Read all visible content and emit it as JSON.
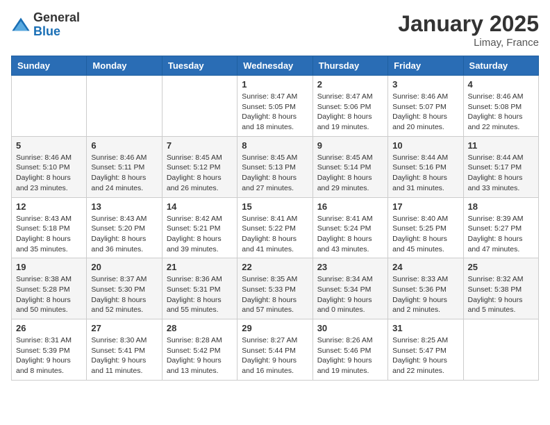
{
  "logo": {
    "general": "General",
    "blue": "Blue"
  },
  "title": "January 2025",
  "location": "Limay, France",
  "days_header": [
    "Sunday",
    "Monday",
    "Tuesday",
    "Wednesday",
    "Thursday",
    "Friday",
    "Saturday"
  ],
  "weeks": [
    [
      {
        "day": "",
        "info": ""
      },
      {
        "day": "",
        "info": ""
      },
      {
        "day": "",
        "info": ""
      },
      {
        "day": "1",
        "info": "Sunrise: 8:47 AM\nSunset: 5:05 PM\nDaylight: 8 hours and 18 minutes."
      },
      {
        "day": "2",
        "info": "Sunrise: 8:47 AM\nSunset: 5:06 PM\nDaylight: 8 hours and 19 minutes."
      },
      {
        "day": "3",
        "info": "Sunrise: 8:46 AM\nSunset: 5:07 PM\nDaylight: 8 hours and 20 minutes."
      },
      {
        "day": "4",
        "info": "Sunrise: 8:46 AM\nSunset: 5:08 PM\nDaylight: 8 hours and 22 minutes."
      }
    ],
    [
      {
        "day": "5",
        "info": "Sunrise: 8:46 AM\nSunset: 5:10 PM\nDaylight: 8 hours and 23 minutes."
      },
      {
        "day": "6",
        "info": "Sunrise: 8:46 AM\nSunset: 5:11 PM\nDaylight: 8 hours and 24 minutes."
      },
      {
        "day": "7",
        "info": "Sunrise: 8:45 AM\nSunset: 5:12 PM\nDaylight: 8 hours and 26 minutes."
      },
      {
        "day": "8",
        "info": "Sunrise: 8:45 AM\nSunset: 5:13 PM\nDaylight: 8 hours and 27 minutes."
      },
      {
        "day": "9",
        "info": "Sunrise: 8:45 AM\nSunset: 5:14 PM\nDaylight: 8 hours and 29 minutes."
      },
      {
        "day": "10",
        "info": "Sunrise: 8:44 AM\nSunset: 5:16 PM\nDaylight: 8 hours and 31 minutes."
      },
      {
        "day": "11",
        "info": "Sunrise: 8:44 AM\nSunset: 5:17 PM\nDaylight: 8 hours and 33 minutes."
      }
    ],
    [
      {
        "day": "12",
        "info": "Sunrise: 8:43 AM\nSunset: 5:18 PM\nDaylight: 8 hours and 35 minutes."
      },
      {
        "day": "13",
        "info": "Sunrise: 8:43 AM\nSunset: 5:20 PM\nDaylight: 8 hours and 36 minutes."
      },
      {
        "day": "14",
        "info": "Sunrise: 8:42 AM\nSunset: 5:21 PM\nDaylight: 8 hours and 39 minutes."
      },
      {
        "day": "15",
        "info": "Sunrise: 8:41 AM\nSunset: 5:22 PM\nDaylight: 8 hours and 41 minutes."
      },
      {
        "day": "16",
        "info": "Sunrise: 8:41 AM\nSunset: 5:24 PM\nDaylight: 8 hours and 43 minutes."
      },
      {
        "day": "17",
        "info": "Sunrise: 8:40 AM\nSunset: 5:25 PM\nDaylight: 8 hours and 45 minutes."
      },
      {
        "day": "18",
        "info": "Sunrise: 8:39 AM\nSunset: 5:27 PM\nDaylight: 8 hours and 47 minutes."
      }
    ],
    [
      {
        "day": "19",
        "info": "Sunrise: 8:38 AM\nSunset: 5:28 PM\nDaylight: 8 hours and 50 minutes."
      },
      {
        "day": "20",
        "info": "Sunrise: 8:37 AM\nSunset: 5:30 PM\nDaylight: 8 hours and 52 minutes."
      },
      {
        "day": "21",
        "info": "Sunrise: 8:36 AM\nSunset: 5:31 PM\nDaylight: 8 hours and 55 minutes."
      },
      {
        "day": "22",
        "info": "Sunrise: 8:35 AM\nSunset: 5:33 PM\nDaylight: 8 hours and 57 minutes."
      },
      {
        "day": "23",
        "info": "Sunrise: 8:34 AM\nSunset: 5:34 PM\nDaylight: 9 hours and 0 minutes."
      },
      {
        "day": "24",
        "info": "Sunrise: 8:33 AM\nSunset: 5:36 PM\nDaylight: 9 hours and 2 minutes."
      },
      {
        "day": "25",
        "info": "Sunrise: 8:32 AM\nSunset: 5:38 PM\nDaylight: 9 hours and 5 minutes."
      }
    ],
    [
      {
        "day": "26",
        "info": "Sunrise: 8:31 AM\nSunset: 5:39 PM\nDaylight: 9 hours and 8 minutes."
      },
      {
        "day": "27",
        "info": "Sunrise: 8:30 AM\nSunset: 5:41 PM\nDaylight: 9 hours and 11 minutes."
      },
      {
        "day": "28",
        "info": "Sunrise: 8:28 AM\nSunset: 5:42 PM\nDaylight: 9 hours and 13 minutes."
      },
      {
        "day": "29",
        "info": "Sunrise: 8:27 AM\nSunset: 5:44 PM\nDaylight: 9 hours and 16 minutes."
      },
      {
        "day": "30",
        "info": "Sunrise: 8:26 AM\nSunset: 5:46 PM\nDaylight: 9 hours and 19 minutes."
      },
      {
        "day": "31",
        "info": "Sunrise: 8:25 AM\nSunset: 5:47 PM\nDaylight: 9 hours and 22 minutes."
      },
      {
        "day": "",
        "info": ""
      }
    ]
  ]
}
